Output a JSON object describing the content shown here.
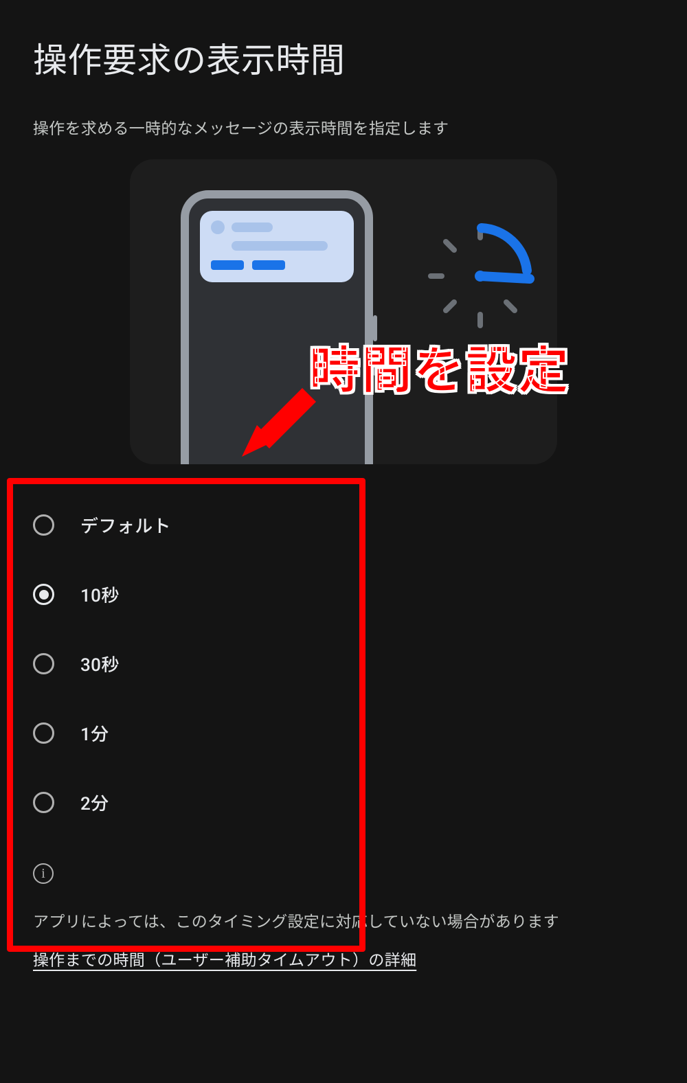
{
  "title": "操作要求の表示時間",
  "subtitle": "操作を求める一時的なメッセージの表示時間を指定します",
  "options": [
    {
      "label": "デフォルト",
      "selected": false
    },
    {
      "label": "10秒",
      "selected": true
    },
    {
      "label": "30秒",
      "selected": false
    },
    {
      "label": "1分",
      "selected": false
    },
    {
      "label": "2分",
      "selected": false
    }
  ],
  "footer_note": "アプリによっては、このタイミング設定に対応していない場合があります",
  "footer_link": "操作までの時間（ユーザー補助タイムアウト）の詳細",
  "annotation": {
    "label": "時間を設定"
  }
}
